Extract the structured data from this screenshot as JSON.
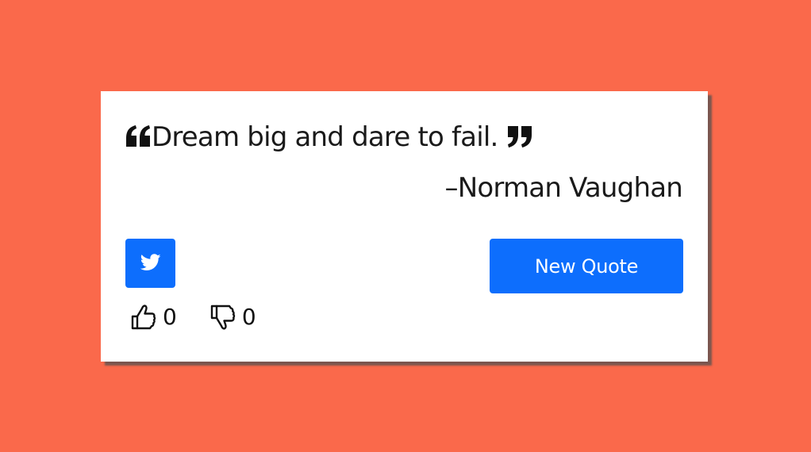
{
  "quote": {
    "text": "Dream big and dare to fail.",
    "author": "–Norman Vaughan"
  },
  "buttons": {
    "new_quote_label": "New Quote",
    "tweet_icon": "twitter-icon"
  },
  "votes": {
    "likes": "0",
    "dislikes": "0",
    "like_icon": "thumbs-up-icon",
    "dislike_icon": "thumbs-down-icon"
  },
  "colors": {
    "background": "#fa694b",
    "card": "#ffffff",
    "accent": "#0d6efd",
    "text": "#1a1a1a"
  }
}
